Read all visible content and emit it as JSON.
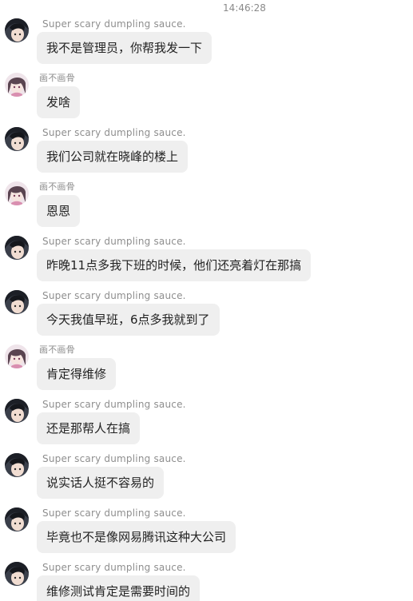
{
  "chat": {
    "timestamp": "14:46:28",
    "messages": [
      {
        "sender": "Super scary dumpling sauce.",
        "avatar": "anime-avatar-dark",
        "text": "我不是管理员，你帮我发一下"
      },
      {
        "sender": "画不画骨",
        "avatar": "anime-avatar-pink",
        "text": "发啥"
      },
      {
        "sender": "Super scary dumpling sauce.",
        "avatar": "anime-avatar-dark",
        "text": "我们公司就在晓峰的楼上"
      },
      {
        "sender": "画不画骨",
        "avatar": "anime-avatar-pink",
        "text": "恩恩"
      },
      {
        "sender": "Super scary dumpling sauce.",
        "avatar": "anime-avatar-dark",
        "text": "昨晚11点多我下班的时候，他们还亮着灯在那搞"
      },
      {
        "sender": "Super scary dumpling sauce.",
        "avatar": "anime-avatar-dark",
        "text": "今天我值早班，6点多我就到了"
      },
      {
        "sender": "画不画骨",
        "avatar": "anime-avatar-pink",
        "text": "肯定得维修"
      },
      {
        "sender": "Super scary dumpling sauce.",
        "avatar": "anime-avatar-dark",
        "text": "还是那帮人在搞"
      },
      {
        "sender": "Super scary dumpling sauce.",
        "avatar": "anime-avatar-dark",
        "text": "说实话人挺不容易的"
      },
      {
        "sender": "Super scary dumpling sauce.",
        "avatar": "anime-avatar-dark",
        "text": "毕竟也不是像网易腾讯这种大公司"
      },
      {
        "sender": "Super scary dumpling sauce.",
        "avatar": "anime-avatar-dark",
        "text": "维修测试肯定是需要时间的"
      }
    ]
  }
}
